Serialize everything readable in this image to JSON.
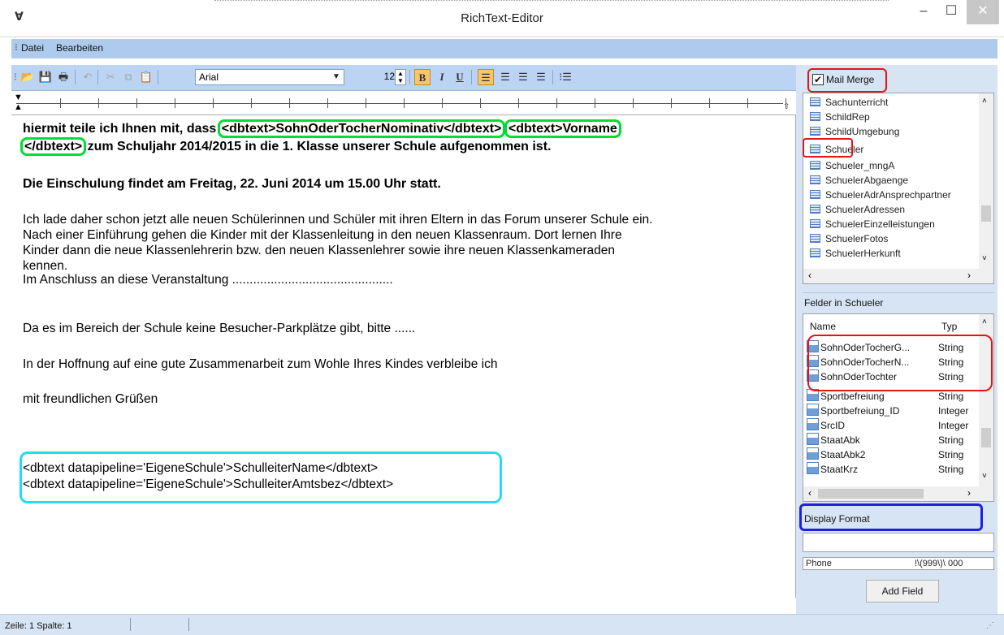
{
  "window": {
    "title": "RichText-Editor",
    "app_icon": "Ɐ",
    "minimize": "–",
    "maximize": "☐",
    "close": "✕"
  },
  "menu": {
    "items": [
      "Datei",
      "Bearbeiten"
    ]
  },
  "toolbar": {
    "font": "Arial",
    "size": "12",
    "bold": "B",
    "italic": "I",
    "underline": "U"
  },
  "editor": {
    "line1_a": "hiermit teile ich Ihnen mit, dass ",
    "line1_field1": "<dbtext>SohnOderTocherNominativ</dbtext>",
    "line1_field2": "<dbtext>Vorname",
    "line2_field2": "</dbtext>",
    "line2_b": " zum Schuljahr 2014/2015 in die 1. Klasse unserer Schule  aufgenommen ist.",
    "p2": "Die Einschulung findet am Freitag, 22. Juni 2014 um 15.00 Uhr statt.",
    "p3_l1": "Ich lade daher schon jetzt alle neuen Schülerinnen und Schüler mit ihren Eltern in das Forum unserer Schule ein.",
    "p3_l2": "Nach einer Einführung gehen die Kinder mit der Klassenleitung in den neuen Klassenraum. Dort lernen Ihre",
    "p3_l3": "Kinder dann die neue Klassenlehrerin bzw. den neuen Klassenlehrer  sowie ihre neuen Klassenkameraden",
    "p3_l4": "kennen.",
    "p3_l5": " Im Anschluss an diese Veranstaltung  ..............................................",
    "p4": "Da es im Bereich der Schule keine Besucher-Parkplätze gibt, bitte ......",
    "p5": "In der Hoffnung auf eine gute Zusammenarbeit zum Wohle Ihres Kindes verbleibe ich",
    "p6": "mit freundlichen Grüßen",
    "sig1": "<dbtext datapipeline='EigeneSchule'>SchulleiterName</dbtext>",
    "sig2": "<dbtext datapipeline='EigeneSchule'>SchulleiterAmtsbez</dbtext>"
  },
  "panel": {
    "mail_merge_label": "Mail Merge",
    "mail_merge_checked": "✔",
    "tables": [
      "Sachunterricht",
      "SchildRep",
      "SchildUmgebung",
      "Schueler",
      "Schueler_mngA",
      "SchuelerAbgaenge",
      "SchuelerAdrAnsprechpartner",
      "SchuelerAdressen",
      "SchuelerEinzelleistungen",
      "SchuelerFotos",
      "SchuelerHerkunft"
    ],
    "fields_header": "Felder in Schueler",
    "col_name": "Name",
    "col_type": "Typ",
    "fields": [
      {
        "name": "SohnOderTocherG...",
        "type": "String"
      },
      {
        "name": "SohnOderTocherN...",
        "type": "String"
      },
      {
        "name": "SohnOderTochter",
        "type": "String"
      },
      {
        "name": "Sportbefreiung",
        "type": "String"
      },
      {
        "name": "Sportbefreiung_ID",
        "type": "Integer"
      },
      {
        "name": "SrcID",
        "type": "Integer"
      },
      {
        "name": "StaatAbk",
        "type": "String"
      },
      {
        "name": "StaatAbk2",
        "type": "String"
      },
      {
        "name": "StaatKrz",
        "type": "String"
      }
    ],
    "display_format_label": "Display Format",
    "phone_label": "Phone",
    "phone_mask": "!\\(999\\)\\ 000",
    "add_field": "Add Field"
  },
  "status": {
    "text": "Zeile:  1  Spalte:  1"
  },
  "colors": {
    "menubar": "#aecbee",
    "toolbar": "#bcd4f3",
    "panel": "#d7e4f4",
    "highlight_green": "#00dd33",
    "highlight_red": "#e21515",
    "highlight_cyan": "#22ddee",
    "highlight_blue": "#1f20dd"
  }
}
